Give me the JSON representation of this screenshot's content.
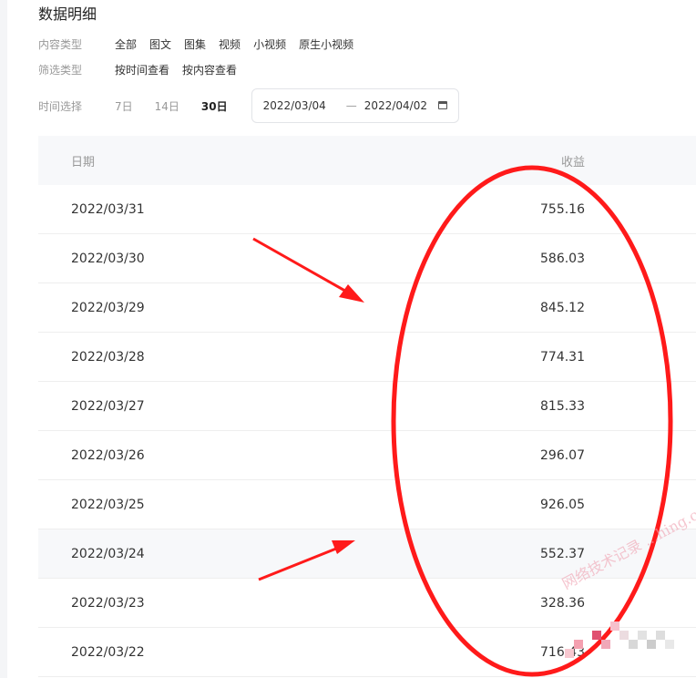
{
  "page": {
    "title": "数据明细"
  },
  "filters": {
    "content_type": {
      "label": "内容类型",
      "options": [
        "全部",
        "图文",
        "图集",
        "视频",
        "小视频",
        "原生小视频"
      ]
    },
    "filter_type": {
      "label": "筛选类型",
      "options": [
        "按时间查看",
        "按内容查看"
      ]
    }
  },
  "time": {
    "label": "时间选择",
    "options": [
      "7日",
      "14日",
      "30日"
    ],
    "active": "30日",
    "start_date": "2022/03/04",
    "end_date": "2022/04/02",
    "separator": "—"
  },
  "table": {
    "headers": {
      "date": "日期",
      "income": "收益"
    },
    "rows": [
      {
        "date": "2022/03/31",
        "income": "755.16"
      },
      {
        "date": "2022/03/30",
        "income": "586.03"
      },
      {
        "date": "2022/03/29",
        "income": "845.12"
      },
      {
        "date": "2022/03/28",
        "income": "774.31"
      },
      {
        "date": "2022/03/27",
        "income": "815.33"
      },
      {
        "date": "2022/03/26",
        "income": "296.07"
      },
      {
        "date": "2022/03/25",
        "income": "926.05"
      },
      {
        "date": "2022/03/24",
        "income": "552.37"
      },
      {
        "date": "2022/03/23",
        "income": "328.36"
      },
      {
        "date": "2022/03/22",
        "income": "716.43"
      }
    ],
    "hovered_row": 7
  },
  "annotations": {
    "color": "#ff1a1a",
    "icons": [
      "red-ellipse",
      "red-arrow"
    ]
  },
  "watermark": {
    "text": "网络技术记录 ...hing.com"
  }
}
